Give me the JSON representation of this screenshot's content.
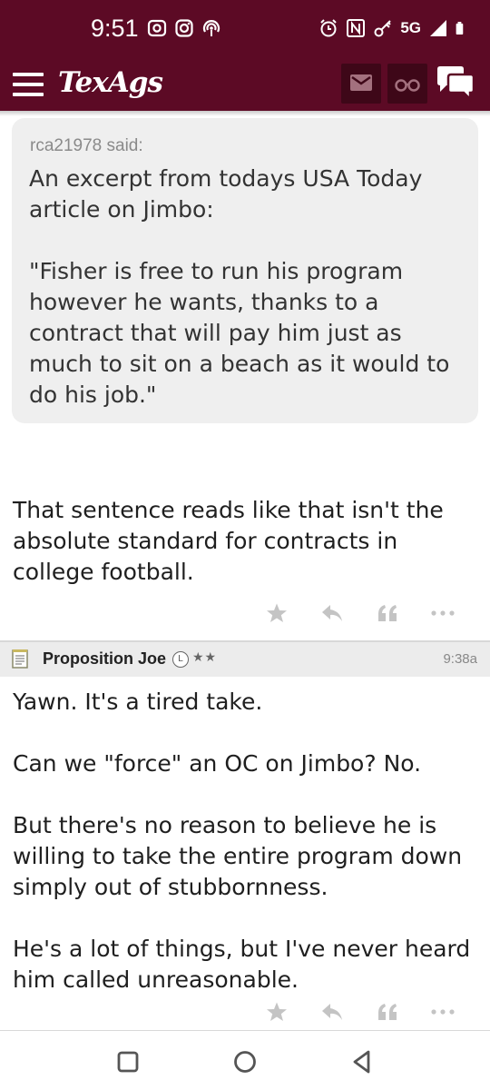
{
  "status": {
    "time": "9:51",
    "network": "5G"
  },
  "header": {
    "logo": "TexAgs"
  },
  "quote": {
    "author": "rca21978 said:",
    "paragraphs": [
      "An excerpt from todays USA Today article on Jimbo:",
      "\"Fisher is free to run his program however he wants, thanks to a contract that will pay him just as much to sit on a beach as it would to do his job.\""
    ]
  },
  "post1": {
    "paragraphs": [
      "That sentence reads like that isn't the absolute standard for contracts in college football."
    ]
  },
  "post2": {
    "author": "Proposition Joe",
    "badge": "L",
    "stars": "★★",
    "time": "9:38a",
    "paragraphs": [
      "Yawn. It's a tired take.",
      "Can we \"force\" an OC on Jimbo? No.",
      "But there's no reason to believe he is willing to take the entire program down simply out of stubbornness.",
      "He's a lot of things, but I've never heard him called unreasonable."
    ]
  },
  "icons": {
    "like": "star-icon",
    "reply": "reply-icon",
    "quote": "quote-icon",
    "more": "more-icon"
  },
  "colors": {
    "brand": "#5c0a25",
    "header_button": "#3e0718",
    "quote_bg": "#efefef"
  }
}
